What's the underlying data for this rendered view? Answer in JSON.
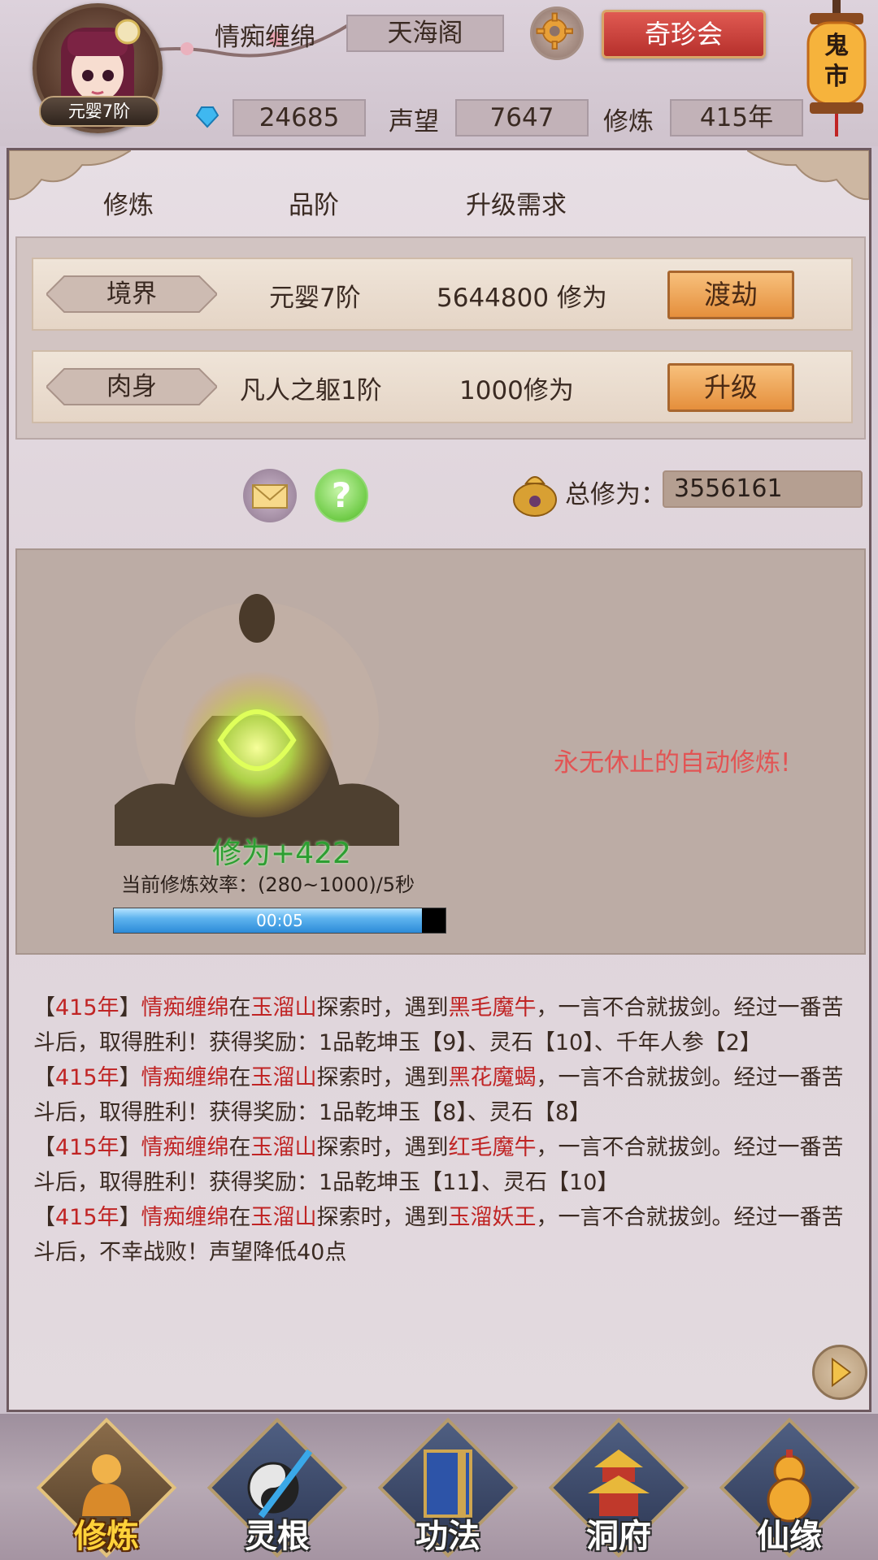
{
  "header": {
    "player_name": "情痴缠绵",
    "guild": "天海阁",
    "level_badge": "元婴7阶",
    "gems": "24685",
    "reputation_label": "声望",
    "reputation": "7647",
    "cultivation_label": "修炼",
    "cultivation_years": "415年",
    "treasure_button": "奇珍会",
    "lantern_text": "鬼市"
  },
  "columns": [
    "修炼",
    "品阶",
    "升级需求"
  ],
  "rows": [
    {
      "tag": "境界",
      "grade": "元婴7阶",
      "requirement": "5644800 修为",
      "button": "渡劫"
    },
    {
      "tag": "肉身",
      "grade": "凡人之躯1阶",
      "requirement": "1000修为",
      "button": "升级"
    }
  ],
  "total": {
    "label": "总修为：",
    "value": "3556161"
  },
  "meditation": {
    "gain": "修为+422",
    "rate": "当前修炼效率：(280~1000)/5秒",
    "timer": "00:05",
    "progress": 0.93,
    "auto_text": "永无休止的自动修炼!"
  },
  "log": [
    {
      "year": "415年",
      "name": "情痴缠绵",
      "place": "玉溜山",
      "enemy": "黑毛魔牛",
      "rest": "，一言不合就拔剑。经过一番苦斗后，取得胜利！获得奖励：1品乾坤玉【9】、灵石【10】、千年人参【2】"
    },
    {
      "year": "415年",
      "name": "情痴缠绵",
      "place": "玉溜山",
      "enemy": "黑花魔蝎",
      "rest": "，一言不合就拔剑。经过一番苦斗后，取得胜利！获得奖励：1品乾坤玉【8】、灵石【8】"
    },
    {
      "year": "415年",
      "name": "情痴缠绵",
      "place": "玉溜山",
      "enemy": "红毛魔牛",
      "rest": "，一言不合就拔剑。经过一番苦斗后，取得胜利！获得奖励：1品乾坤玉【11】、灵石【10】"
    },
    {
      "year": "415年",
      "name": "情痴缠绵",
      "place": "玉溜山",
      "enemy": "玉溜妖王",
      "rest": "，一言不合就拔剑。经过一番苦斗后，不幸战败！声望降低40点"
    }
  ],
  "log_fixed": {
    "explore_mid": "在",
    "explore_end": "探索时，遇到"
  },
  "nav": [
    {
      "label": "修炼",
      "icon": "meditating-monk-icon",
      "active": true
    },
    {
      "label": "灵根",
      "icon": "sword-orb-icon",
      "active": false
    },
    {
      "label": "功法",
      "icon": "book-icon",
      "active": false
    },
    {
      "label": "洞府",
      "icon": "pagoda-icon",
      "active": false
    },
    {
      "label": "仙缘",
      "icon": "gourd-icon",
      "active": false
    }
  ]
}
